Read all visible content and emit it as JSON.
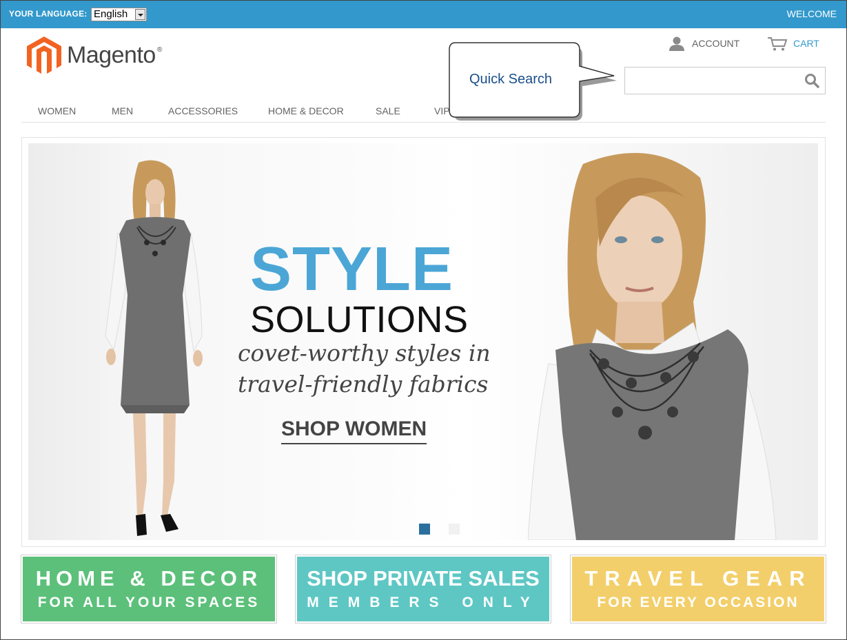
{
  "topbar": {
    "language_label": "YOUR LANGUAGE:",
    "language_value": "English",
    "welcome": "WELCOME",
    "bg_color": "#3399cc"
  },
  "header": {
    "logo_text": "Magento",
    "logo_mark": "®",
    "account_label": "ACCOUNT",
    "cart_label": "CART",
    "search_placeholder": "",
    "search_icon": "search-icon",
    "account_icon": "user-icon",
    "cart_icon": "cart-icon"
  },
  "nav": {
    "items": [
      "WOMEN",
      "MEN",
      "ACCESSORIES",
      "HOME & DECOR",
      "SALE",
      "VIP"
    ]
  },
  "callout": {
    "text": "Quick Search"
  },
  "banner": {
    "headline": "STYLE",
    "subheadline": "SOLUTIONS",
    "tagline_line1": "covet-worthy styles in",
    "tagline_line2": "travel-friendly fabrics",
    "cta": "SHOP WOMEN",
    "headline_color": "#4ba6d6",
    "slides_total": 2,
    "active_slide": 1
  },
  "promos": [
    {
      "title": "HOME & DECOR",
      "subtitle": "FOR ALL YOUR SPACES",
      "color": "#5cc07a"
    },
    {
      "title": "SHOP PRIVATE SALES",
      "subtitle": "MEMBERS ONLY",
      "color": "#5ec7c4"
    },
    {
      "title": "TRAVEL GEAR",
      "subtitle": "FOR EVERY OCCASION",
      "color": "#f3cf6b"
    }
  ]
}
